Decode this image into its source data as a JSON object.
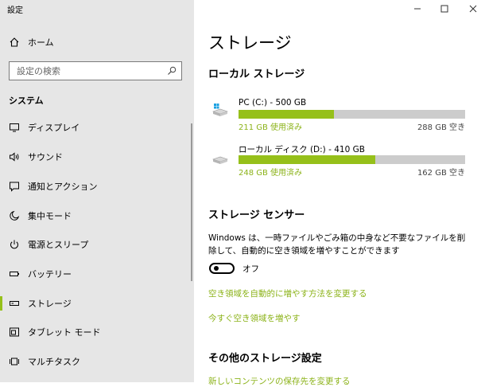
{
  "window": {
    "title": "設定"
  },
  "sidebar": {
    "home_label": "ホーム",
    "search_placeholder": "設定の検索",
    "section_title": "システム",
    "items": [
      {
        "label": "ディスプレイ",
        "icon": "monitor-icon"
      },
      {
        "label": "サウンド",
        "icon": "speaker-icon"
      },
      {
        "label": "通知とアクション",
        "icon": "notification-icon"
      },
      {
        "label": "集中モード",
        "icon": "moon-icon"
      },
      {
        "label": "電源とスリープ",
        "icon": "power-icon"
      },
      {
        "label": "バッテリー",
        "icon": "battery-icon"
      },
      {
        "label": "ストレージ",
        "icon": "storage-icon",
        "selected": true
      },
      {
        "label": "タブレット モード",
        "icon": "tablet-icon"
      },
      {
        "label": "マルチタスク",
        "icon": "multitask-icon"
      }
    ]
  },
  "main": {
    "title": "ストレージ",
    "local_storage": {
      "title": "ローカル ストレージ",
      "drives": [
        {
          "name": "PC (C:) - 500 GB",
          "used": "211 GB 使用済み",
          "free": "288 GB 空き",
          "used_fraction": 0.42,
          "icon": "windows-drive-icon"
        },
        {
          "name": "ローカル ディスク (D:) - 410 GB",
          "used": "248 GB 使用済み",
          "free": "162 GB 空き",
          "used_fraction": 0.605,
          "icon": "drive-icon"
        }
      ]
    },
    "storage_sense": {
      "title": "ストレージ センサー",
      "description": "Windows は、一時ファイルやごみ箱の中身など不要なファイルを削除して、自動的に空き領域を増やすことができます",
      "toggle_label": "オフ",
      "toggle_on": false,
      "links": [
        "空き領域を自動的に増やす方法を変更する",
        "今すぐ空き領域を増やす"
      ]
    },
    "other": {
      "title": "その他のストレージ設定",
      "link": "新しいコンテンツの保存先を変更する"
    }
  },
  "colors": {
    "accent": "#96c01a",
    "sidebar_bg": "#e6e6e6",
    "bar_track": "#cccccc"
  }
}
